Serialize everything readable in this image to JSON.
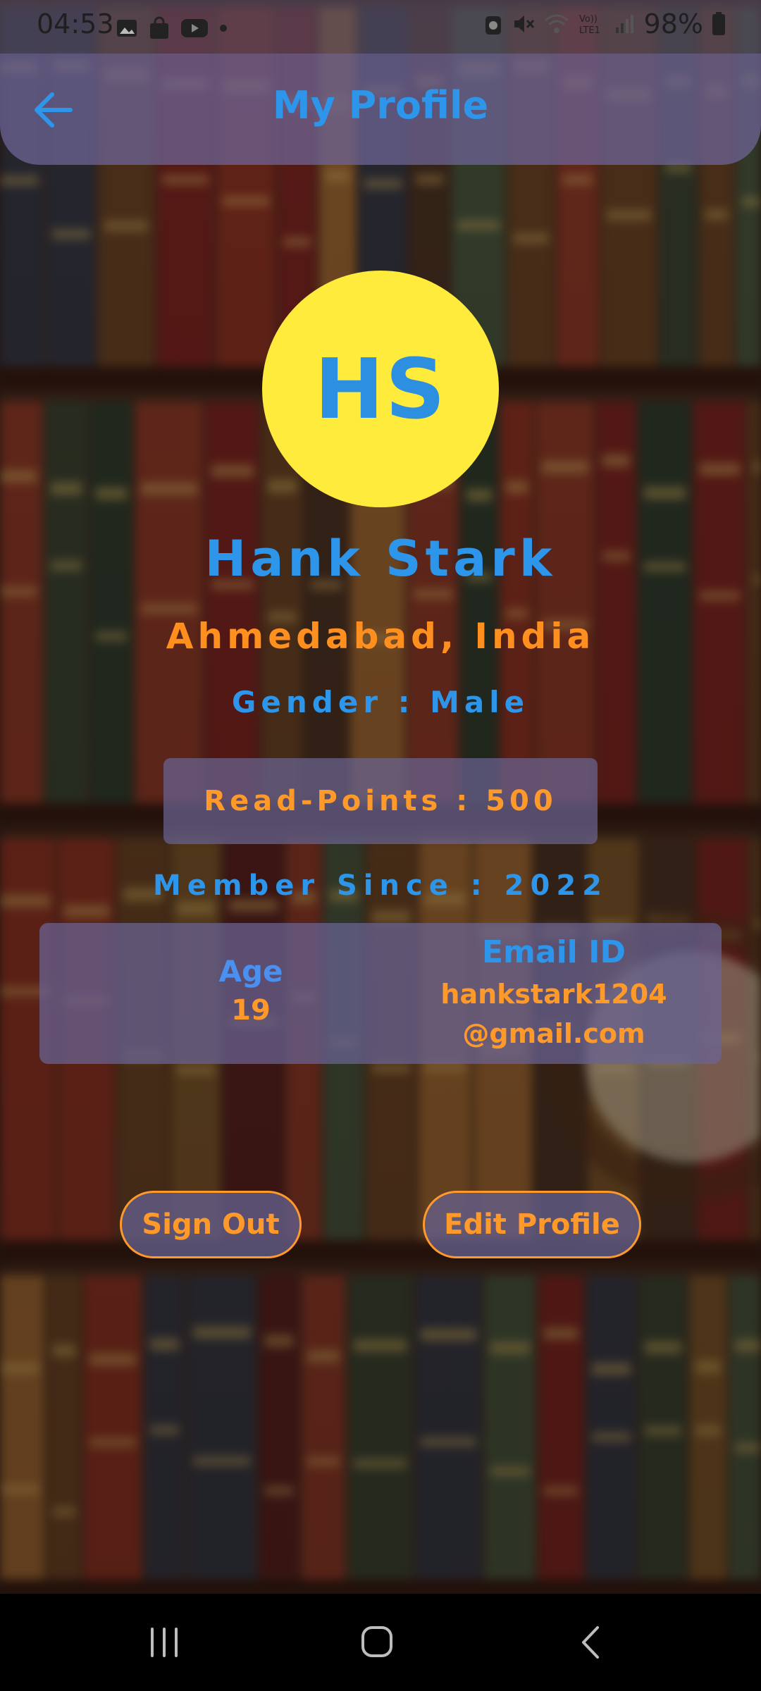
{
  "status_bar": {
    "time": "04:53",
    "battery_percent": "98%",
    "left_icons": [
      "gallery-icon",
      "shopping-bag-icon",
      "youtube-icon",
      "dot-icon"
    ],
    "right_icons": [
      "alarm-icon",
      "mute-icon",
      "wifi-icon",
      "volte-lte-icon",
      "signal-icon",
      "battery-icon"
    ]
  },
  "app_bar": {
    "title": "My Profile",
    "back_icon": "arrow-back-icon"
  },
  "profile": {
    "initials": "HS",
    "name": "Hank Stark",
    "location": "Ahmedabad, India",
    "gender": "Gender : Male",
    "read_points": "Read-Points : 500",
    "member_since": "Member Since : 2022",
    "age_label": "Age",
    "age_value": "19",
    "email_label": "Email ID",
    "email_line1": "hankstark1204",
    "email_line2": "@gmail.com"
  },
  "actions": {
    "sign_out": "Sign Out",
    "edit_profile": "Edit Profile"
  },
  "colors": {
    "accent_blue": "#2d95ea",
    "accent_orange": "#ff9a2a",
    "avatar_yellow": "#ffeb3b",
    "panel": "#6964a0"
  },
  "nav_bar": {
    "buttons": [
      "recent-apps-icon",
      "home-icon",
      "back-icon"
    ]
  }
}
